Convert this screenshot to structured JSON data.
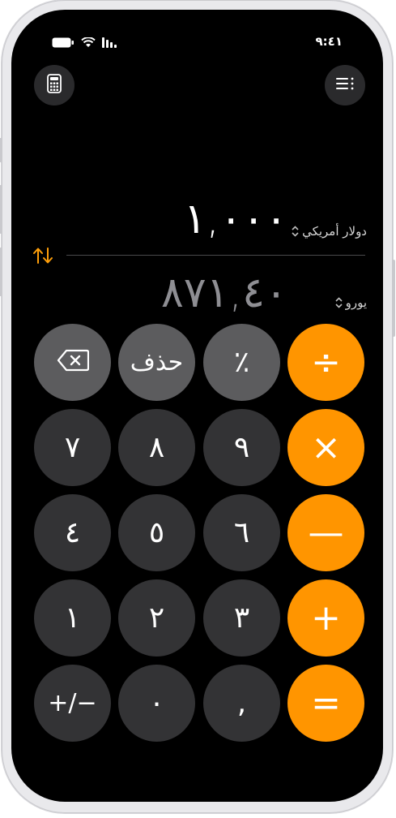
{
  "status": {
    "time": "٩:٤١"
  },
  "converter": {
    "from_amount": "١,٠٠٠",
    "from_currency": "دولار أمريكي",
    "to_amount": "٨٧١,٤٠",
    "to_currency": "يورو"
  },
  "keys": {
    "backspace": "⌫",
    "clear": "حذف",
    "percent": "٪",
    "divide": "÷",
    "seven": "٧",
    "eight": "٨",
    "nine": "٩",
    "multiply": "×",
    "four": "٤",
    "five": "٥",
    "six": "٦",
    "minus": "—",
    "one": "١",
    "two": "٢",
    "three": "٣",
    "plus": "+",
    "plus_minus": "+/−",
    "zero": "٠",
    "decimal": ",",
    "equals": "="
  },
  "colors": {
    "accent": "#ff9500",
    "key_dark": "#333335",
    "key_gray": "#5c5c5e"
  }
}
